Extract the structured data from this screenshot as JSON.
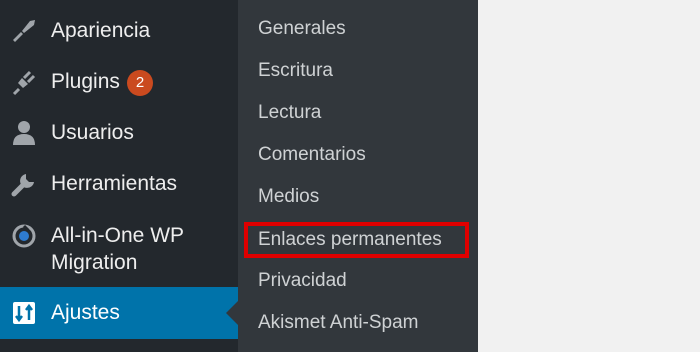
{
  "sidebar": {
    "items": [
      {
        "label": "Apariencia",
        "icon": "brush-icon"
      },
      {
        "label": "Plugins",
        "icon": "plug-icon",
        "badge": "2"
      },
      {
        "label": "Usuarios",
        "icon": "user-icon"
      },
      {
        "label": "Herramientas",
        "icon": "wrench-icon"
      },
      {
        "label": "All-in-One WP",
        "label_line2": "Migration",
        "icon": "migration-icon"
      },
      {
        "label": "Ajustes",
        "icon": "settings-icon",
        "active": true
      }
    ]
  },
  "submenu": {
    "items": [
      {
        "label": "Generales"
      },
      {
        "label": "Escritura"
      },
      {
        "label": "Lectura"
      },
      {
        "label": "Comentarios"
      },
      {
        "label": "Medios"
      },
      {
        "label": "Enlaces permanentes",
        "highlighted": true
      },
      {
        "label": "Privacidad"
      },
      {
        "label": "Akismet Anti-Spam"
      }
    ]
  },
  "colors": {
    "sidebar_bg": "#23282d",
    "submenu_bg": "#32373c",
    "active_bg": "#0073aa",
    "badge_bg": "#ca4a1f",
    "highlight_border": "#e00000",
    "content_bg": "#f1f1f1"
  }
}
